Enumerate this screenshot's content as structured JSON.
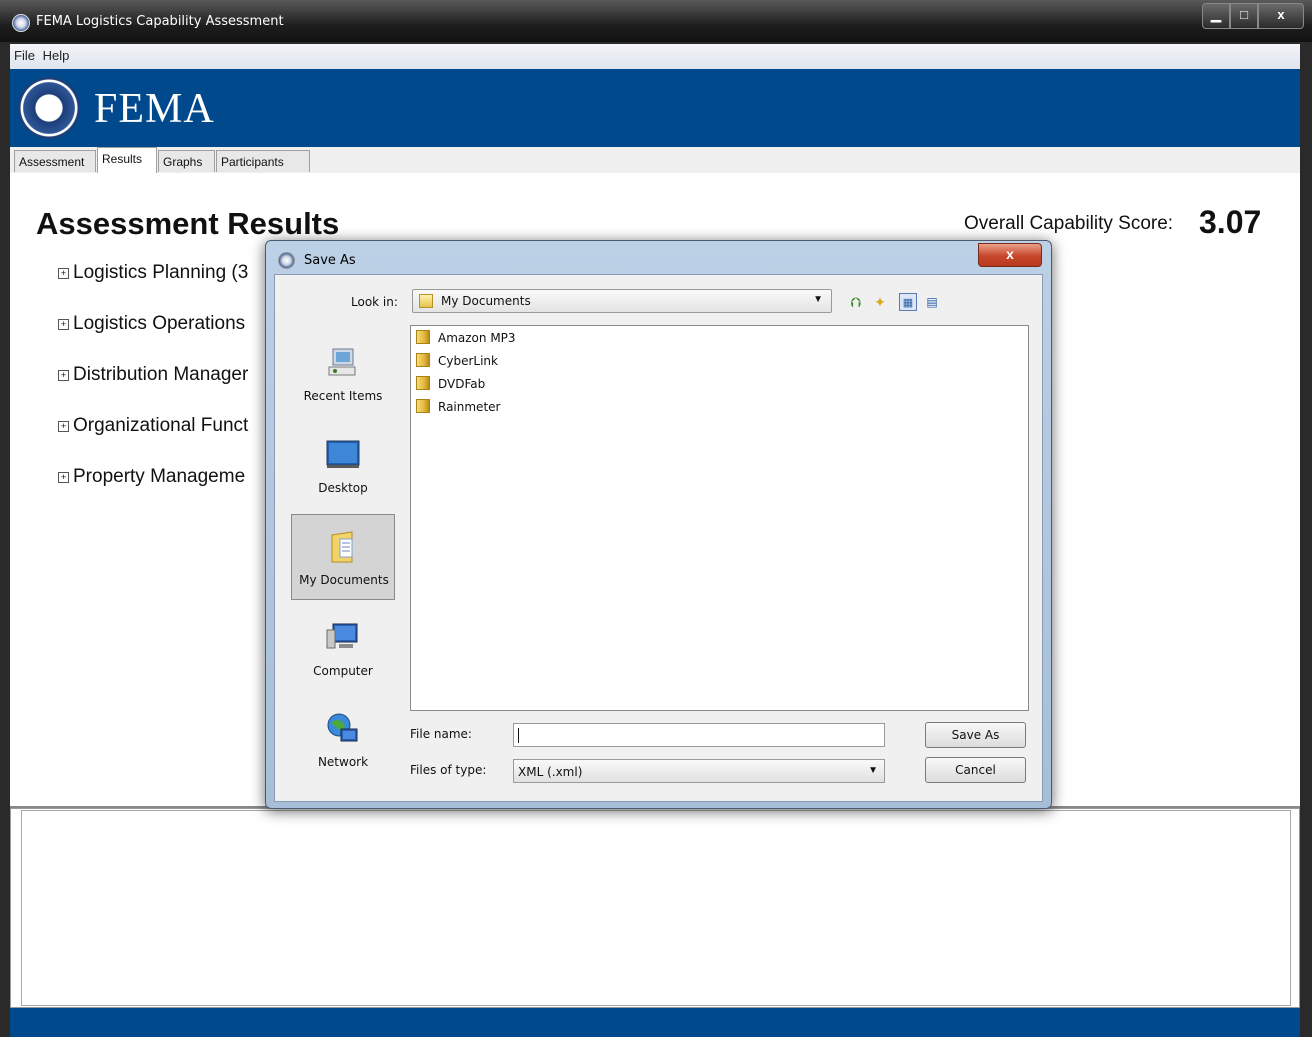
{
  "window": {
    "title": "FEMA Logistics Capability Assessment",
    "min_glyph": "▁",
    "max_glyph": "□",
    "close_glyph": "x"
  },
  "menu": {
    "items": [
      "File",
      "Help"
    ]
  },
  "banner": {
    "brand": "FEMA",
    "brand_color": "#00498d"
  },
  "tabs": [
    "Assessment",
    "Results",
    "Graphs",
    "Participants"
  ],
  "active_tab": "Results",
  "results": {
    "heading": "Assessment Results",
    "score_label": "Overall Capability Score:",
    "score_value": "3.07",
    "expand_glyph": "+",
    "categories": [
      "Logistics Planning (3",
      "Logistics Operations",
      "Distribution Manager",
      "Organizational Funct",
      "Property Manageme"
    ]
  },
  "dialog": {
    "title": "Save As",
    "close_glyph": "x",
    "look_in_label": "Look in:",
    "look_in_value": "My Documents",
    "places": [
      "Recent Items",
      "Desktop",
      "My Documents",
      "Computer",
      "Network"
    ],
    "selected_place": "My Documents",
    "files": [
      "Amazon MP3",
      "CyberLink",
      "DVDFab",
      "Rainmeter"
    ],
    "file_name_label": "File name:",
    "file_name_value": "",
    "files_of_type_label": "Files of type:",
    "files_of_type_value": "XML (.xml)",
    "save_button": "Save As",
    "cancel_button": "Cancel"
  }
}
